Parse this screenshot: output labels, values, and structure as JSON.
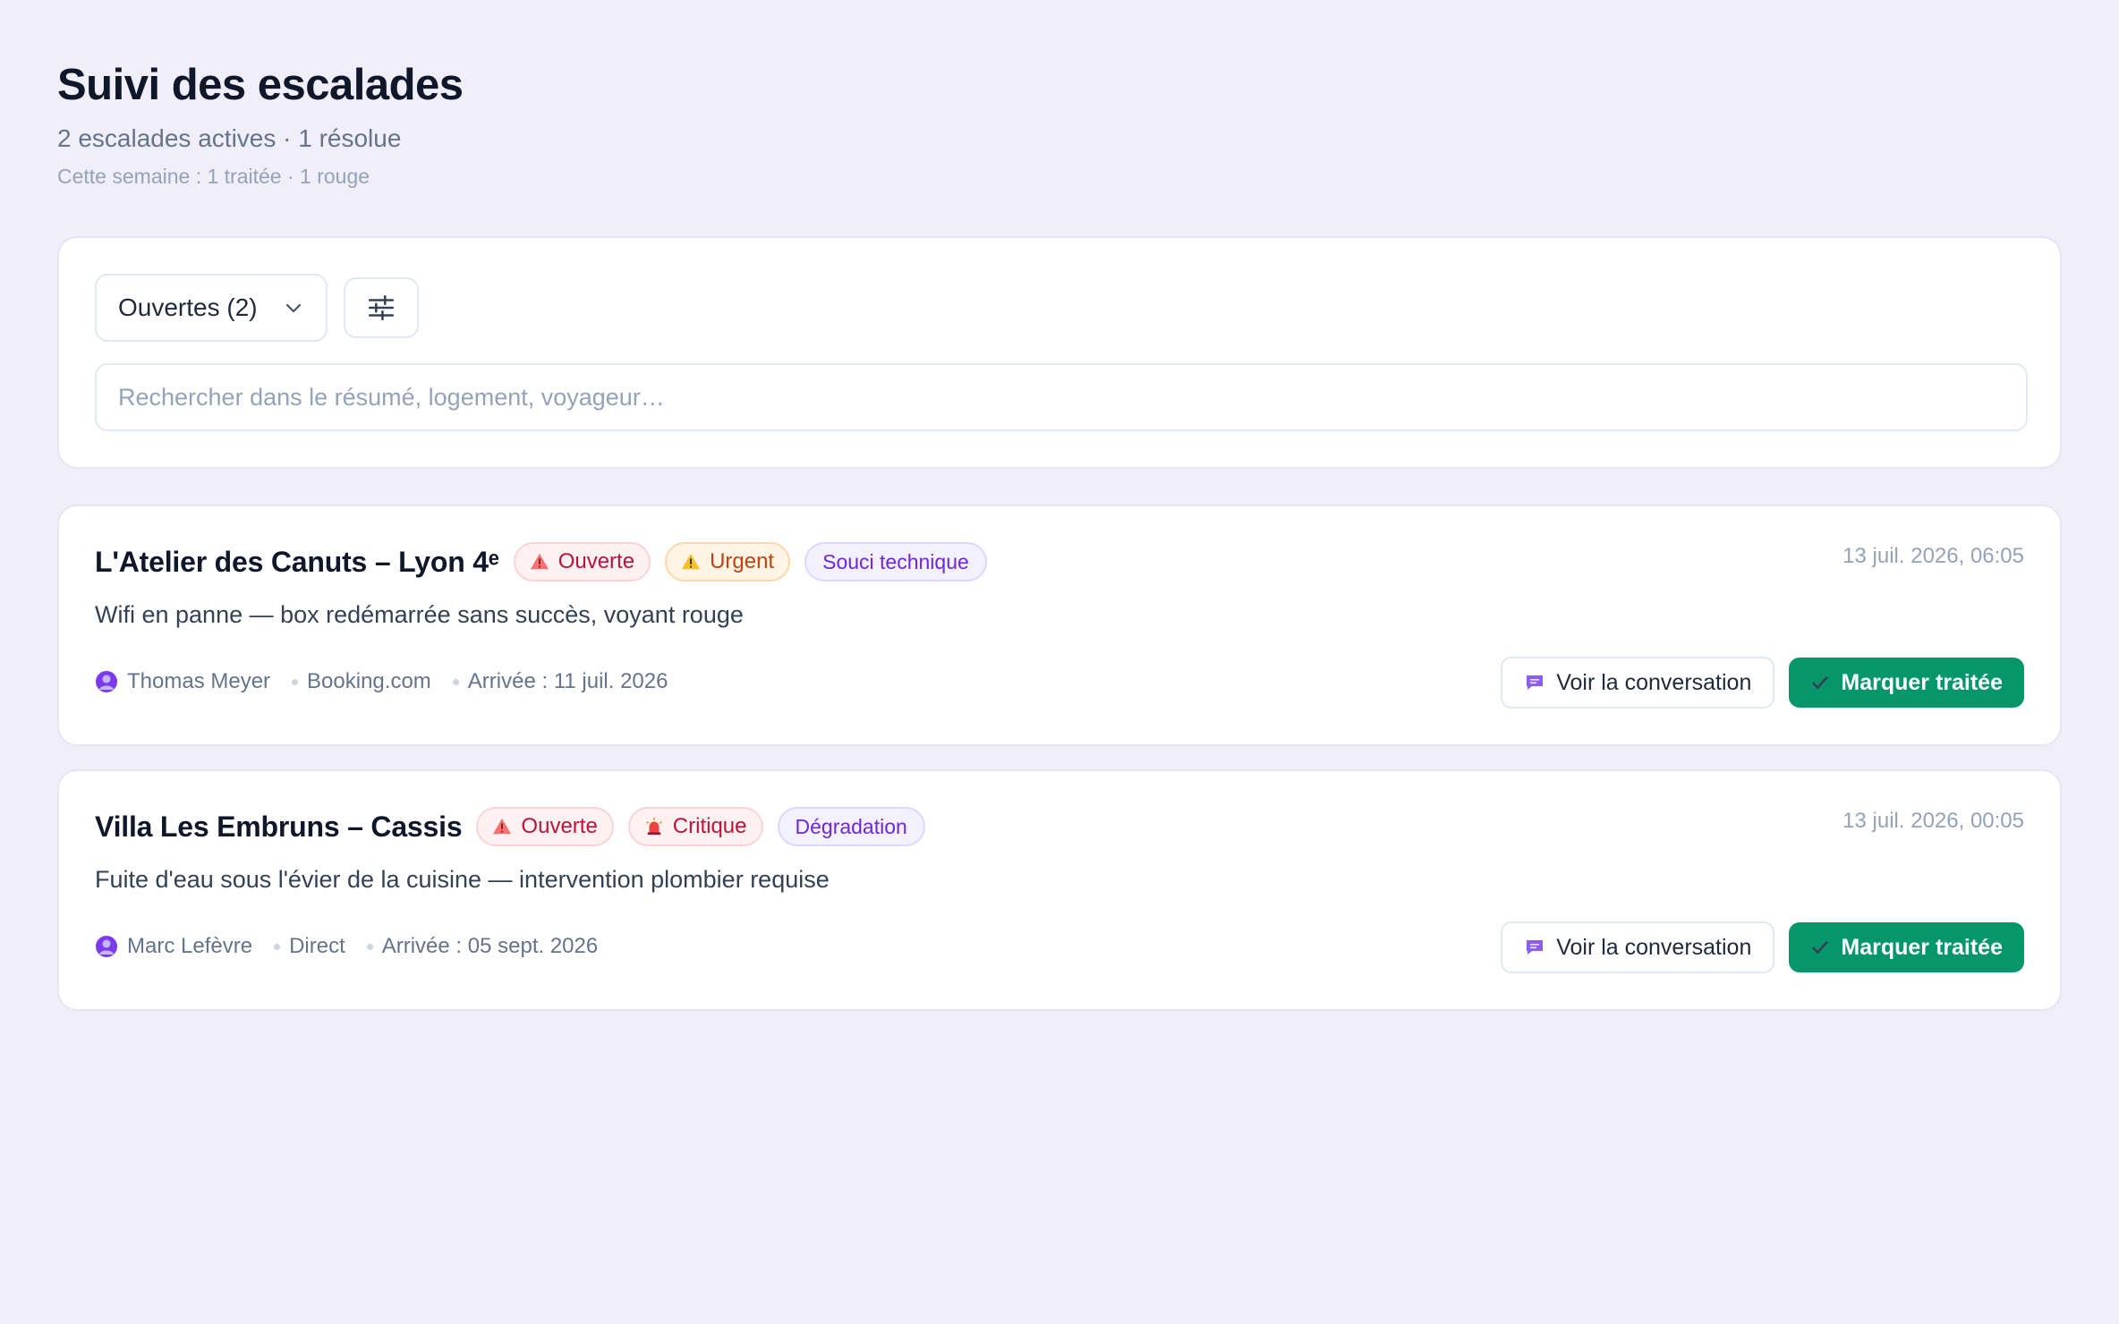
{
  "header": {
    "title": "Suivi des escalades",
    "subtitle": "2 escalades actives · 1 résolue",
    "week": "Cette semaine : 1 traitée · 1 rouge"
  },
  "filters": {
    "status_value": "Ouvertes (2)",
    "search_placeholder": "Rechercher dans le résumé, logement, voyageur…",
    "icons": [
      "chevron-down-icon",
      "sliders-icon"
    ]
  },
  "escalations": [
    {
      "property": "L'Atelier des Canuts – Lyon 4ᵉ",
      "status": "Ouverte",
      "priority": "Urgent",
      "category": "Souci technique",
      "date": "13 juil. 2026, 06:05",
      "summary": "Wifi en panne — box redémarrée sans succès, voyant rouge",
      "guest": "Thomas Meyer",
      "channel": "Booking.com",
      "arrival": "Arrivée : 11 juil. 2026",
      "view_label": "Voir la conversation",
      "done_label": "Marquer traitée"
    },
    {
      "property": "Villa Les Embruns – Cassis",
      "status": "Ouverte",
      "priority": "Critique",
      "category": "Dégradation",
      "date": "13 juil. 2026, 00:05",
      "summary": "Fuite d'eau sous l'évier de la cuisine — intervention plombier requise",
      "guest": "Marc Lefèvre",
      "channel": "Direct",
      "arrival": "Arrivée : 05 sept. 2026",
      "view_label": "Voir la conversation",
      "done_label": "Marquer traitée"
    }
  ],
  "colors": {
    "background": "#f0eef8",
    "primary_button": "#059669",
    "open_badge": "#be123c",
    "urgent_badge": "#c2410c",
    "category_badge": "#6d28d9"
  }
}
